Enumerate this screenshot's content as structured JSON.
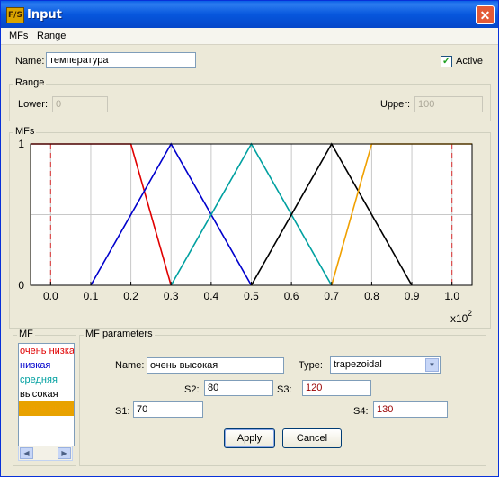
{
  "window": {
    "title": "Input",
    "icon_text": "F/S",
    "close_glyph": "✕"
  },
  "menu": {
    "items": [
      "MFs",
      "Range"
    ]
  },
  "name": {
    "label": "Name:",
    "value": "температура"
  },
  "active": {
    "label": "Active",
    "checked": true
  },
  "range": {
    "title": "Range",
    "lower_label": "Lower:",
    "lower_value": "0",
    "upper_label": "Upper:",
    "upper_value": "100"
  },
  "mfs_title": "MFs",
  "chart_data": {
    "type": "line",
    "xlim": [
      -0.05,
      1.05
    ],
    "ylim": [
      0,
      1
    ],
    "x_ticks": [
      "0.0",
      "0.1",
      "0.2",
      "0.3",
      "0.4",
      "0.5",
      "0.6",
      "0.7",
      "0.8",
      "0.9",
      "1.0"
    ],
    "y_ticks": [
      "0",
      "1"
    ],
    "x_multiplier": "x10",
    "x_multiplier_exp": "2",
    "grid": true,
    "series": [
      {
        "name": "очень низкая",
        "color": "#e00000",
        "x": [
          -0.05,
          0.2,
          0.3
        ],
        "y": [
          1,
          1,
          0
        ]
      },
      {
        "name": "низкая",
        "color": "#0000cc",
        "x": [
          0.1,
          0.3,
          0.5
        ],
        "y": [
          0,
          1,
          0
        ]
      },
      {
        "name": "средняя",
        "color": "#00a0a0",
        "x": [
          0.3,
          0.5,
          0.7
        ],
        "y": [
          0,
          1,
          0
        ]
      },
      {
        "name": "высокая",
        "color": "#000000",
        "x": [
          0.5,
          0.7,
          0.9
        ],
        "y": [
          0,
          1,
          0
        ]
      },
      {
        "name": "очень высокая",
        "color": "#f0a000",
        "x": [
          0.7,
          0.8,
          1.05
        ],
        "y": [
          0,
          1,
          1
        ]
      }
    ],
    "range_markers": [
      0.0,
      1.0
    ]
  },
  "mf_list": {
    "title": "MF",
    "items": [
      {
        "label": "очень низкая",
        "color": "#e00000"
      },
      {
        "label": "низкая",
        "color": "#0000cc"
      },
      {
        "label": "средняя",
        "color": "#00a0a0"
      },
      {
        "label": "высокая",
        "color": "#000000"
      },
      {
        "label": "очень высокая",
        "color": "#f0a000",
        "selected": true
      }
    ]
  },
  "mf_params": {
    "title": "MF parameters",
    "name_label": "Name:",
    "name_value": "очень высокая",
    "type_label": "Type:",
    "type_value": "trapezoidal",
    "s1_label": "S1:",
    "s1_value": "70",
    "s2_label": "S2:",
    "s2_value": "80",
    "s3_label": "S3:",
    "s3_value": "120",
    "s4_label": "S4:",
    "s4_value": "130",
    "apply_label": "Apply",
    "cancel_label": "Cancel"
  }
}
